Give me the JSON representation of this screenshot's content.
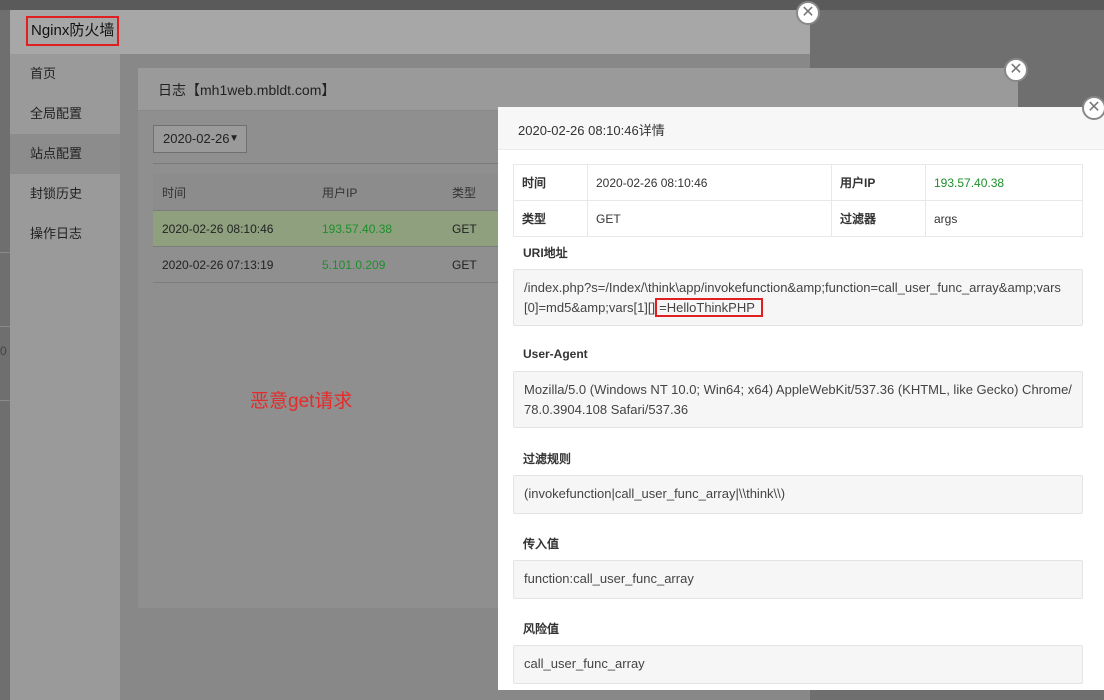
{
  "background": {
    "edge_text": "0"
  },
  "firewall": {
    "title": "Nginx防火墙",
    "close_icon": "close-icon",
    "nav": [
      {
        "label": "首页"
      },
      {
        "label": "全局配置"
      },
      {
        "label": "站点配置"
      },
      {
        "label": "封锁历史"
      },
      {
        "label": "操作日志"
      }
    ]
  },
  "log_modal": {
    "title": "日志【mh1web.mbldt.com】",
    "date_select": "2020-02-26",
    "columns": [
      "时间",
      "用户IP",
      "类型"
    ],
    "rows": [
      {
        "time": "2020-02-26 08:10:46",
        "ip": "193.57.40.38",
        "type": "GET"
      },
      {
        "time": "2020-02-26 07:13:19",
        "ip": "5.101.0.209",
        "type": "GET"
      }
    ],
    "annotation": "恶意get请求"
  },
  "detail": {
    "title": "2020-02-26 08:10:46详情",
    "info": {
      "time_label": "时间",
      "time_value": "2020-02-26 08:10:46",
      "ip_label": "用户IP",
      "ip_value": "193.57.40.38",
      "type_label": "类型",
      "type_value": "GET",
      "filter_label": "过滤器",
      "filter_value": "args"
    },
    "uri_label": "URI地址",
    "uri_value_main": "/index.php?s=/Index/\\think\\app/invokefunction&amp;function=call_user_func_array&amp;vars[0]=md5&amp;vars[1][]",
    "uri_value_highlight": "=HelloThinkPHP",
    "ua_label": "User-Agent",
    "ua_value": "Mozilla/5.0 (Windows NT 10.0; Win64; x64) AppleWebKit/537.36 (KHTML, like Gecko) Chrome/78.0.3904.108 Safari/537.36",
    "rule_label": "过滤规则",
    "rule_value": "(invokefunction|call_user_func_array|\\\\think\\\\)",
    "input_label": "传入值",
    "input_value": "function:call_user_func_array",
    "risk_label": "风险值",
    "risk_value": "call_user_func_array"
  }
}
